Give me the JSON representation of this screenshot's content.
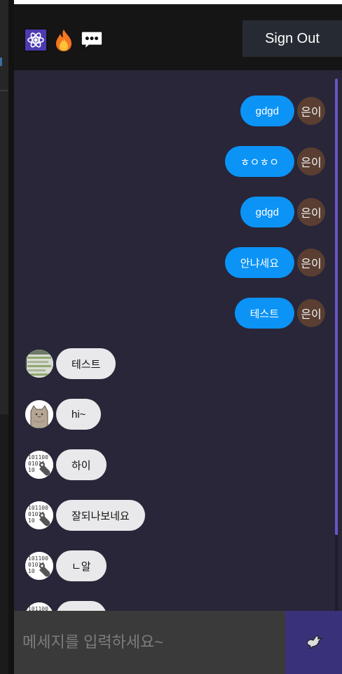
{
  "header": {
    "logos": [
      "atom-icon",
      "fire-icon",
      "speech-bubble-icon"
    ],
    "sign_out_label": "Sign Out"
  },
  "messages": [
    {
      "direction": "out",
      "text": "gdgd",
      "author": "은이"
    },
    {
      "direction": "out",
      "text": "ㅎㅇㅎㅇ",
      "author": "은이"
    },
    {
      "direction": "out",
      "text": "gdgd",
      "author": "은이"
    },
    {
      "direction": "out",
      "text": "안냐세요",
      "author": "은이"
    },
    {
      "direction": "out",
      "text": "테스트",
      "author": "은이"
    },
    {
      "direction": "in",
      "text": "테스트",
      "avatar": "screenshot-avatar"
    },
    {
      "direction": "in",
      "text": "hi~",
      "avatar": "cat-avatar"
    },
    {
      "direction": "in",
      "text": "하이",
      "avatar": "binary-wrench-avatar"
    },
    {
      "direction": "in",
      "text": "잘되나보네요",
      "avatar": "binary-wrench-avatar"
    },
    {
      "direction": "in",
      "text": "ㄴ알",
      "avatar": "binary-wrench-avatar"
    },
    {
      "direction": "in",
      "text": "",
      "avatar": "binary-wrench-avatar"
    }
  ],
  "composer": {
    "placeholder": "메세지를 입력하세요~",
    "value": "",
    "send_icon": "dove-icon"
  },
  "colors": {
    "outgoing_bubble": "#0b93f6",
    "incoming_bubble": "#e9e9eb",
    "chat_background": "#282638",
    "header_background": "#151515",
    "send_button": "#39327a",
    "scrollbar": "#6b55c7"
  }
}
